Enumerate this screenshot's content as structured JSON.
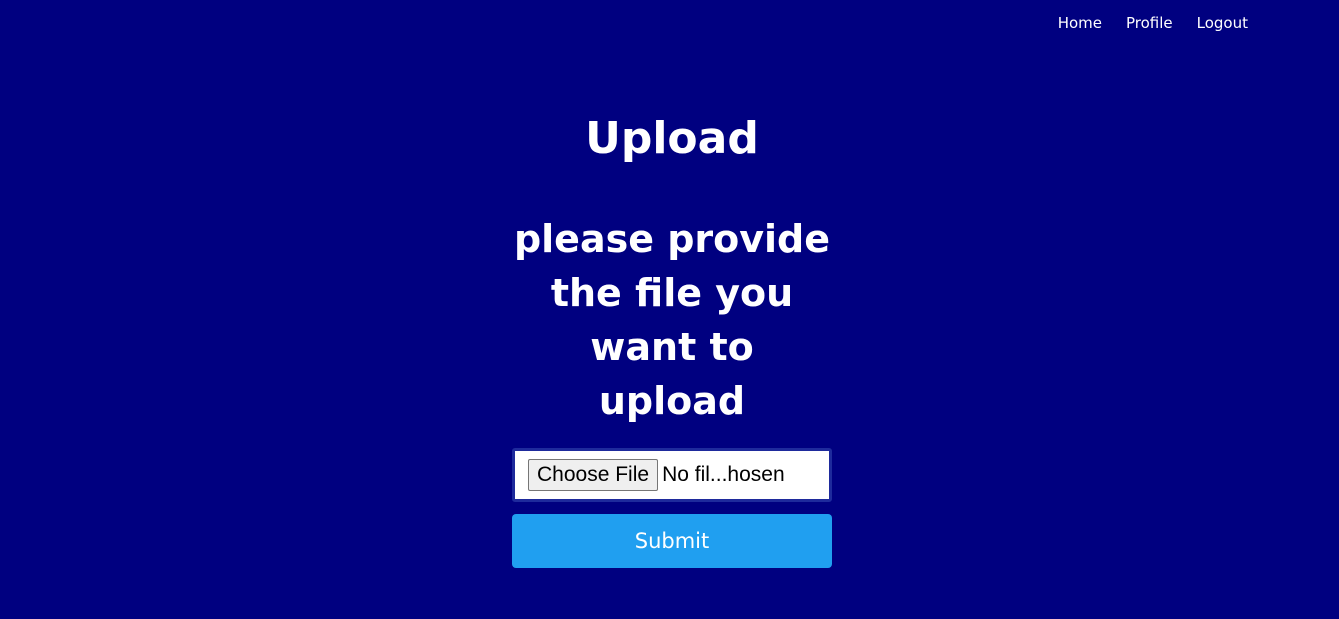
{
  "nav": {
    "items": [
      {
        "label": "Home"
      },
      {
        "label": "Profile"
      },
      {
        "label": "Logout"
      }
    ]
  },
  "main": {
    "title": "Upload",
    "subtitle": "please provide the file you want to upload",
    "file_input": {
      "button_label": "Choose File",
      "status_text": "No fil...hosen"
    },
    "submit_label": "Submit"
  },
  "colors": {
    "background": "#000080",
    "submit_button": "#209ff0",
    "text": "#ffffff"
  }
}
